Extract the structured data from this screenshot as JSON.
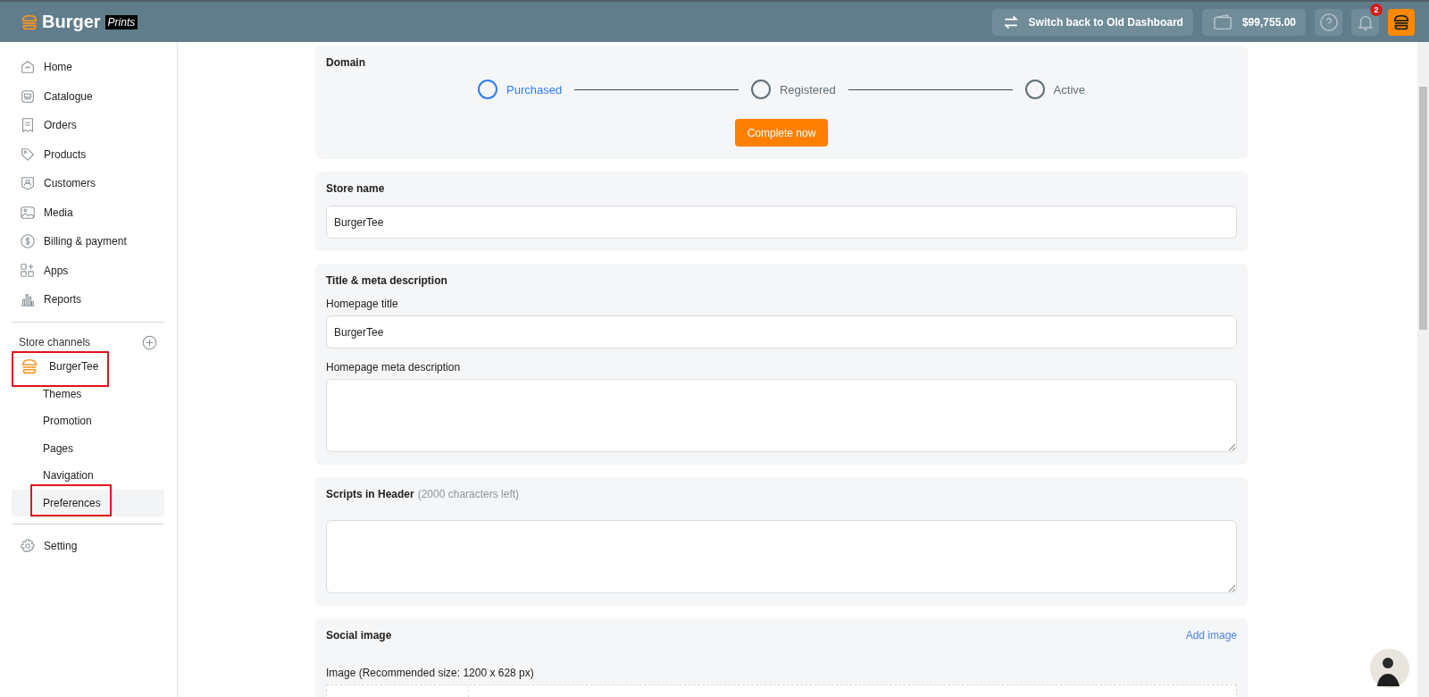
{
  "header": {
    "logo_word": "Burger",
    "logo_tag": "Prints",
    "switch_button": "Switch back to Old Dashboard",
    "balance": "$99,755.00",
    "notification_count": "2"
  },
  "sidebar": {
    "items": [
      {
        "label": "Home"
      },
      {
        "label": "Catalogue"
      },
      {
        "label": "Orders"
      },
      {
        "label": "Products"
      },
      {
        "label": "Customers"
      },
      {
        "label": "Media"
      },
      {
        "label": "Billing & payment"
      },
      {
        "label": "Apps"
      },
      {
        "label": "Reports"
      }
    ],
    "channels_heading": "Store channels",
    "store": {
      "name": "BurgerTee",
      "highlighted": true
    },
    "sub_items": [
      {
        "label": "Themes",
        "selected": false,
        "highlighted": false
      },
      {
        "label": "Promotion",
        "selected": false,
        "highlighted": false
      },
      {
        "label": "Pages",
        "selected": false,
        "highlighted": false
      },
      {
        "label": "Navigation",
        "selected": false,
        "highlighted": false
      },
      {
        "label": "Preferences",
        "selected": true,
        "highlighted": true
      }
    ],
    "setting": "Setting"
  },
  "domain": {
    "title": "Domain",
    "steps": [
      {
        "label": "Purchased",
        "current": true
      },
      {
        "label": "Registered",
        "current": false
      },
      {
        "label": "Active",
        "current": false
      }
    ],
    "button": "Complete now"
  },
  "store_name": {
    "title": "Store name",
    "value": "BurgerTee"
  },
  "meta": {
    "title": "Title & meta description",
    "homepage_title_label": "Homepage title",
    "homepage_title_value": "BurgerTee",
    "description_label": "Homepage meta description"
  },
  "scripts": {
    "title": "Scripts in Header",
    "hint": "(2000 characters left)"
  },
  "social": {
    "title": "Social image",
    "link": "Add image",
    "image_label": "Image (Recommended size: 1200 x 628 px)"
  }
}
